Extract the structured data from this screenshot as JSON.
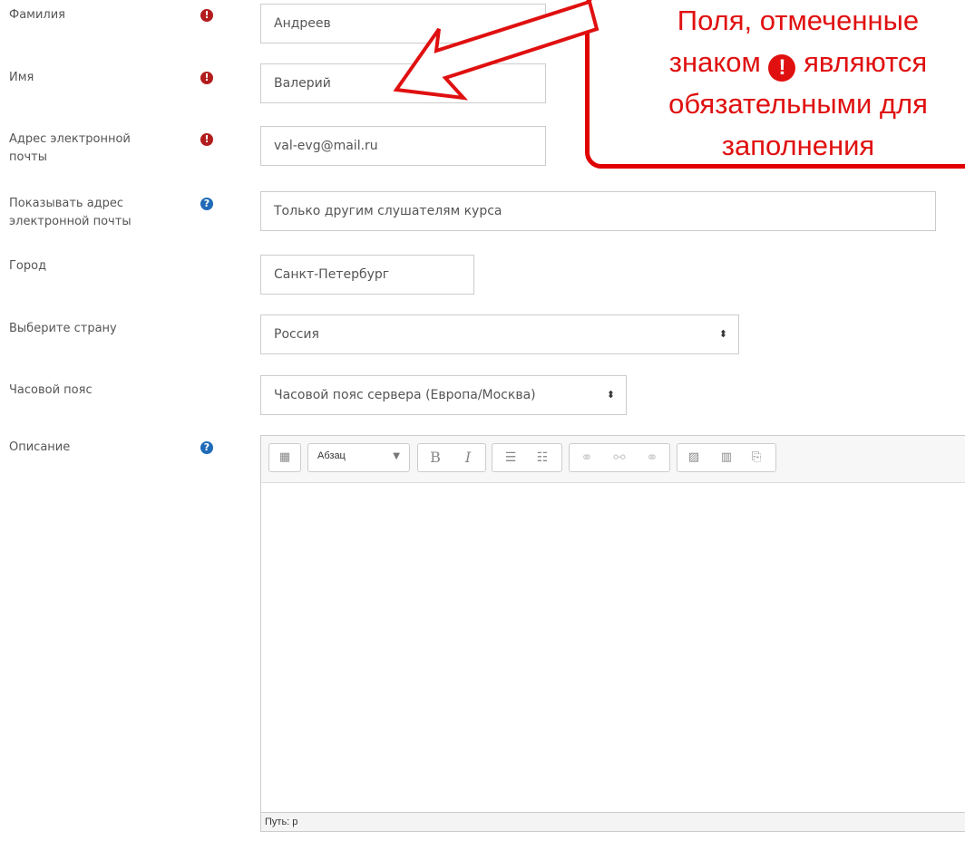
{
  "fields": {
    "lastname": {
      "label": "Фамилия",
      "value": "Андреев"
    },
    "firstname": {
      "label": "Имя",
      "value": "Валерий"
    },
    "email": {
      "label": "Адрес электронной почты",
      "value": "val-evg@mail.ru"
    },
    "email_display": {
      "label": "Показывать адрес электронной почты",
      "value": "Только другим слушателям курса"
    },
    "city": {
      "label": "Город",
      "value": "Санкт-Петербург"
    },
    "country": {
      "label": "Выберите страну",
      "value": "Россия"
    },
    "timezone": {
      "label": "Часовой пояс",
      "value": "Часовой пояс сервера (Европа/Москва)"
    },
    "description": {
      "label": "Описание"
    }
  },
  "icons": {
    "required": "!",
    "help": "?",
    "select_arrow": "⬍"
  },
  "editor": {
    "format_select": "Абзац",
    "path_label": "Путь: p"
  },
  "callout": {
    "line1": "Поля, отмеченные",
    "line2a": "знаком",
    "line2b": "являются",
    "line3": "обязательными для",
    "line4": "заполнения"
  },
  "colors": {
    "required": "#b31d1d",
    "help": "#1f6bb8",
    "callout": "#e01010"
  }
}
